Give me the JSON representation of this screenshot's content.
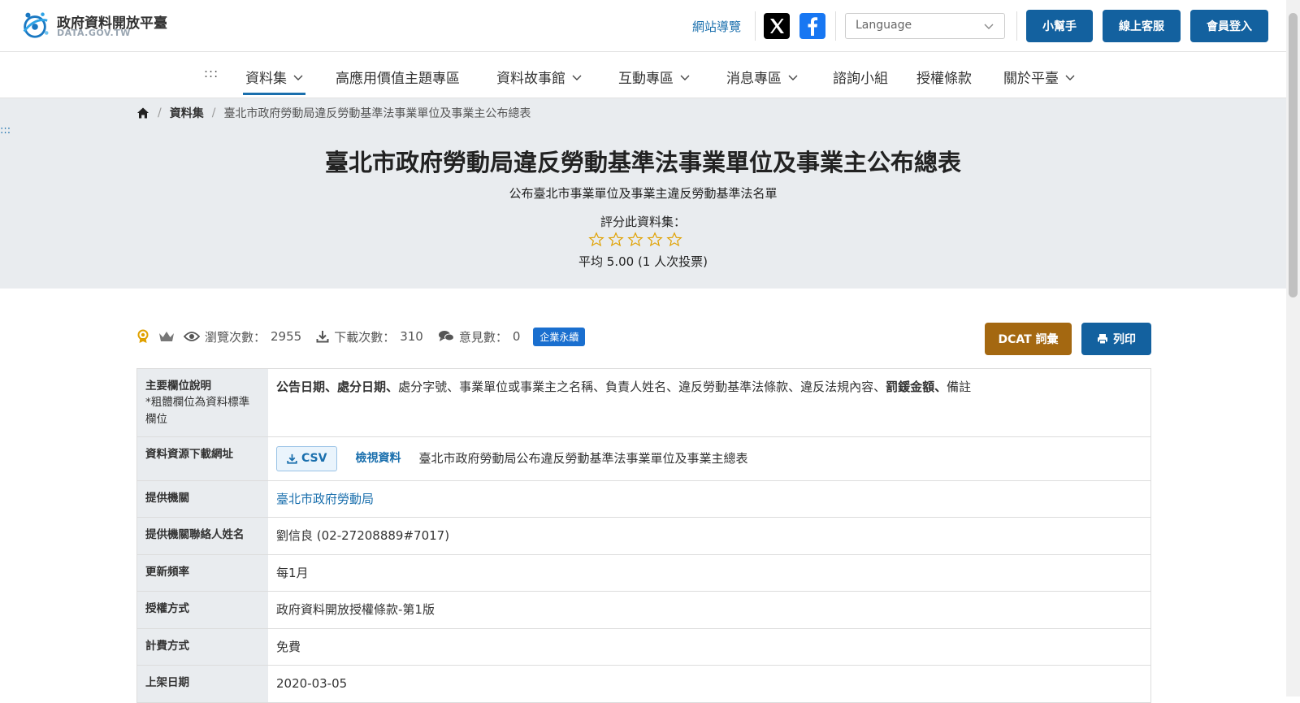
{
  "header": {
    "logo_title": "政府資料開放平臺",
    "logo_subtitle": "DATA.GOV.TW",
    "sitemap": "網站導覽",
    "language_placeholder": "Language",
    "buttons": [
      "小幫手",
      "線上客服",
      "會員登入"
    ]
  },
  "nav": {
    "dots": ":::",
    "items": [
      "資料集",
      "高應用價值主題專區",
      "資料故事館",
      "互動專區",
      "消息專區",
      "諮詢小組",
      "授權條款",
      "關於平臺"
    ]
  },
  "hero": {
    "skip": ":::",
    "breadcrumb": {
      "section": "資料集",
      "current": "臺北市政府勞動局違反勞動基準法事業單位及事業主公布總表"
    },
    "title": "臺北市政府勞動局違反勞動基準法事業單位及事業主公布總表",
    "subtitle": "公布臺北市事業單位及事業主違反勞動基準法名單",
    "rate_label": "評分此資料集：",
    "rating_stars": 5,
    "rating_avg": "平均 5.00 (1 人次投票)"
  },
  "stats": {
    "views_label": "瀏覽次數：",
    "views": "2955",
    "downloads_label": "下載次數：",
    "downloads": "310",
    "comments_label": "意見數：",
    "comments": "0",
    "badge": "企業永續",
    "dcat": "DCAT 詞彙",
    "print": "列印"
  },
  "table": {
    "fields_header": "主要欄位說明",
    "fields_note": "*粗體欄位為資料標準欄位",
    "fields_parts": [
      {
        "text": "公告日期",
        "bold": true
      },
      {
        "text": "、",
        "bold": true
      },
      {
        "text": "處分日期",
        "bold": true
      },
      {
        "text": "、",
        "bold": true
      },
      {
        "text": "處分字號、事業單位或事業主之名稱、負責人姓名、違反勞動基準法條款、違反法規內容、",
        "bold": false
      },
      {
        "text": "罰鍰金額",
        "bold": true
      },
      {
        "text": "、",
        "bold": true
      },
      {
        "text": "備註",
        "bold": false
      }
    ],
    "download_header": "資料資源下載網址",
    "csv": "CSV",
    "view_data": "檢視資料",
    "resource_name": "臺北市政府勞動局公布違反勞動基準法事業單位及事業主總表",
    "rows": [
      {
        "label": "提供機關",
        "value": "臺北市政府勞動局",
        "link": true
      },
      {
        "label": "提供機關聯絡人姓名",
        "value": "劉信良 (02-27208889#7017)",
        "link": false
      },
      {
        "label": "更新頻率",
        "value": "每1月",
        "link": false
      },
      {
        "label": "授權方式",
        "value": "政府資料開放授權條款-第1版",
        "link": false
      },
      {
        "label": "計費方式",
        "value": "免費",
        "link": false
      },
      {
        "label": "上架日期",
        "value": "2020-03-05",
        "link": false
      }
    ]
  },
  "colors": {
    "primary": "#13619f",
    "link": "#1a6fad",
    "dcat": "#a46811",
    "hero_bg": "#e9ecef",
    "star": "#e0a100"
  }
}
